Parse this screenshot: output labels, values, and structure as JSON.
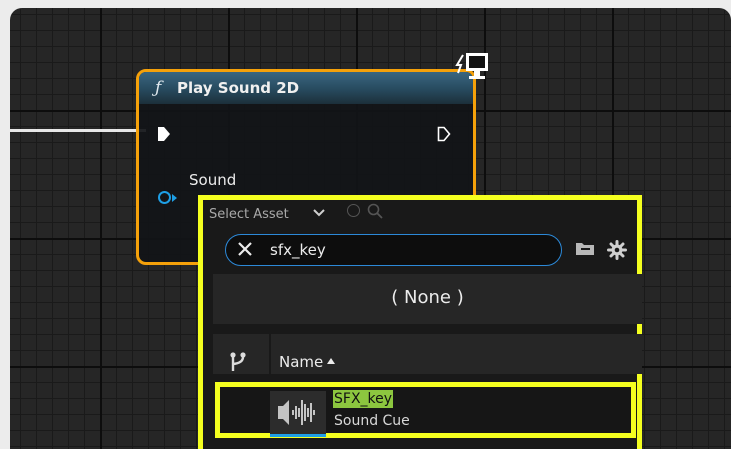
{
  "node": {
    "title": "Play Sound 2D",
    "func_icon": "ƒ",
    "sound_pin_label": "Sound",
    "accent_color": "#f5a10a",
    "header_color": "#3a6680"
  },
  "picker": {
    "select_asset_label": "Select Asset",
    "search": {
      "value": "sfx_key",
      "placeholder": ""
    },
    "none_label": "( None )",
    "column_name": "Name",
    "results": [
      {
        "name": "SFX_key",
        "type": "Sound Cue",
        "icon": "sound-wave-icon"
      }
    ],
    "highlight_color": "#f4ff1f",
    "match_highlight_color": "#8cc63f"
  }
}
